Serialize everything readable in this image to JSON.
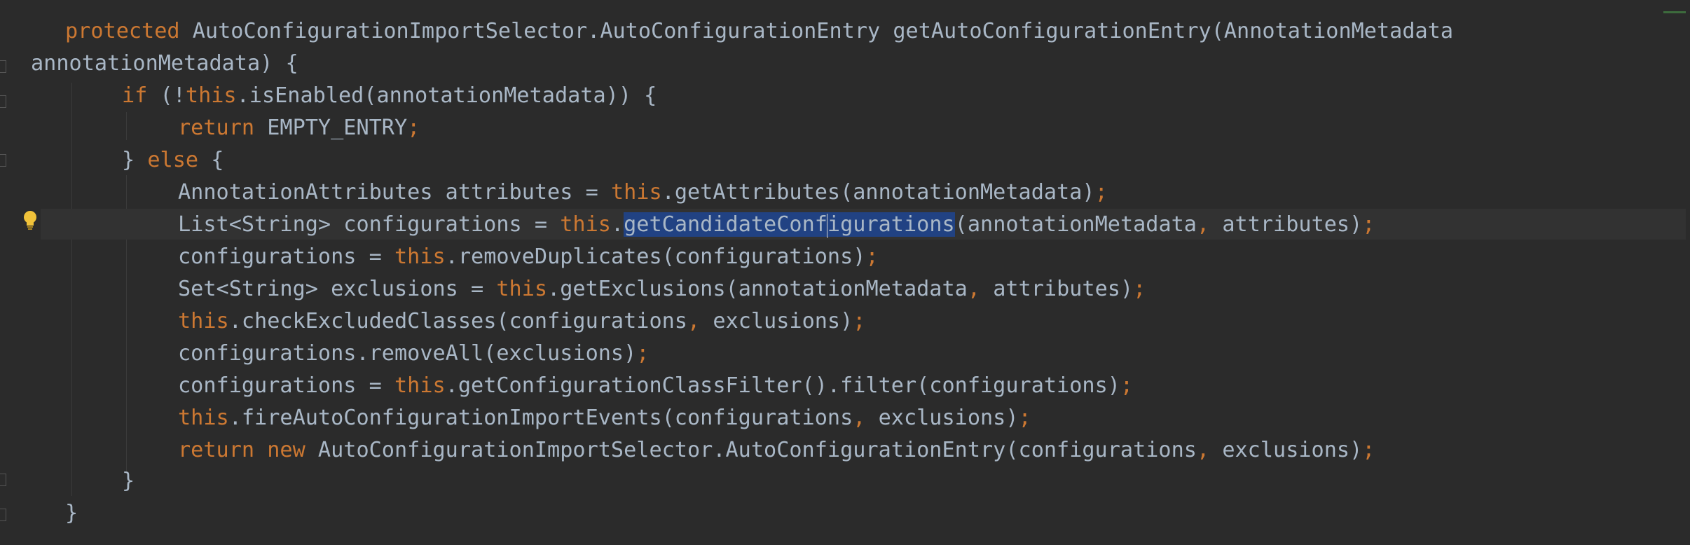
{
  "editor": {
    "lines": [
      {
        "tokens": [
          {
            "t": "protected ",
            "c": "kw"
          },
          {
            "t": "AutoConfigurationImportSelector.AutoConfigurationEntry getAutoConfigurationEntry(AnnotationMetadata",
            "c": "pl"
          }
        ]
      },
      {
        "tokens": [
          {
            "t": "annotationMetadata) {",
            "c": "pl"
          }
        ]
      },
      {
        "tokens": [
          {
            "t": "if ",
            "c": "kw"
          },
          {
            "t": "(!",
            "c": "pl"
          },
          {
            "t": "this",
            "c": "kw"
          },
          {
            "t": ".isEnabled(annotationMetadata)) {",
            "c": "pl"
          }
        ]
      },
      {
        "tokens": [
          {
            "t": "return ",
            "c": "kw"
          },
          {
            "t": "EMPTY_ENTRY",
            "c": "pl"
          },
          {
            "t": ";",
            "c": "kw"
          }
        ]
      },
      {
        "tokens": [
          {
            "t": "} ",
            "c": "pl"
          },
          {
            "t": "else ",
            "c": "kw"
          },
          {
            "t": "{",
            "c": "pl"
          }
        ]
      },
      {
        "tokens": [
          {
            "t": "AnnotationAttributes attributes = ",
            "c": "pl"
          },
          {
            "t": "this",
            "c": "kw"
          },
          {
            "t": ".getAttributes(annotationMetadata)",
            "c": "pl"
          },
          {
            "t": ";",
            "c": "kw"
          }
        ]
      },
      {
        "tokens": [
          {
            "t": "List<String> configurations = ",
            "c": "pl"
          },
          {
            "t": "this",
            "c": "kw"
          },
          {
            "t": ".",
            "c": "pl"
          },
          {
            "t": "getCandidateConf",
            "c": "sel"
          },
          {
            "t": "",
            "c": "caret"
          },
          {
            "t": "igurations",
            "c": "sel"
          },
          {
            "t": "(annotationMetadata",
            "c": "pl"
          },
          {
            "t": ", ",
            "c": "kw"
          },
          {
            "t": "attributes)",
            "c": "pl"
          },
          {
            "t": ";",
            "c": "kw"
          }
        ]
      },
      {
        "tokens": [
          {
            "t": "configurations = ",
            "c": "pl"
          },
          {
            "t": "this",
            "c": "kw"
          },
          {
            "t": ".removeDuplicates(configurations)",
            "c": "pl"
          },
          {
            "t": ";",
            "c": "kw"
          }
        ]
      },
      {
        "tokens": [
          {
            "t": "Set<String> exclusions = ",
            "c": "pl"
          },
          {
            "t": "this",
            "c": "kw"
          },
          {
            "t": ".getExclusions(annotationMetadata",
            "c": "pl"
          },
          {
            "t": ", ",
            "c": "kw"
          },
          {
            "t": "attributes)",
            "c": "pl"
          },
          {
            "t": ";",
            "c": "kw"
          }
        ]
      },
      {
        "tokens": [
          {
            "t": "this",
            "c": "kw"
          },
          {
            "t": ".checkExcludedClasses(configurations",
            "c": "pl"
          },
          {
            "t": ", ",
            "c": "kw"
          },
          {
            "t": "exclusions)",
            "c": "pl"
          },
          {
            "t": ";",
            "c": "kw"
          }
        ]
      },
      {
        "tokens": [
          {
            "t": "configurations.removeAll(exclusions)",
            "c": "pl"
          },
          {
            "t": ";",
            "c": "kw"
          }
        ]
      },
      {
        "tokens": [
          {
            "t": "configurations = ",
            "c": "pl"
          },
          {
            "t": "this",
            "c": "kw"
          },
          {
            "t": ".getConfigurationClassFilter().filter(configurations)",
            "c": "pl"
          },
          {
            "t": ";",
            "c": "kw"
          }
        ]
      },
      {
        "tokens": [
          {
            "t": "this",
            "c": "kw"
          },
          {
            "t": ".fireAutoConfigurationImportEvents(configurations",
            "c": "pl"
          },
          {
            "t": ", ",
            "c": "kw"
          },
          {
            "t": "exclusions)",
            "c": "pl"
          },
          {
            "t": ";",
            "c": "kw"
          }
        ]
      },
      {
        "tokens": [
          {
            "t": "return new ",
            "c": "kw"
          },
          {
            "t": "AutoConfigurationImportSelector.AutoConfigurationEntry(configurations",
            "c": "pl"
          },
          {
            "t": ", ",
            "c": "kw"
          },
          {
            "t": "exclusions)",
            "c": "pl"
          },
          {
            "t": ";",
            "c": "kw"
          }
        ]
      },
      {
        "tokens": [
          {
            "t": "}",
            "c": "pl"
          }
        ]
      },
      {
        "tokens": [
          {
            "t": "}",
            "c": "pl"
          }
        ]
      }
    ],
    "gutter": {
      "intention_icon": "lightbulb-icon"
    },
    "colors": {
      "background": "#2b2b2b",
      "keyword": "#cc7832",
      "plain": "#a9b7c6",
      "selection": "#214283",
      "current_line": "#323232",
      "bulb": "#f0c23a"
    }
  }
}
